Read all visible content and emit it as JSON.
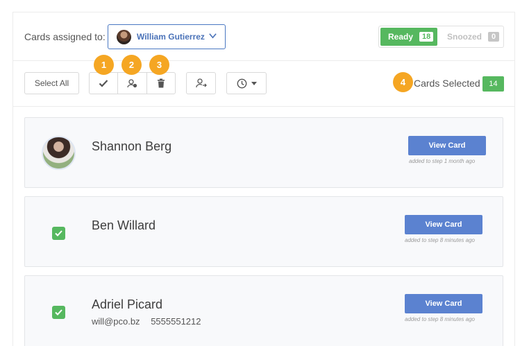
{
  "header": {
    "assigned_label": "Cards assigned to:",
    "assignee_name": "William Gutierrez",
    "ready_label": "Ready",
    "ready_count": "18",
    "snoozed_label": "Snoozed",
    "snoozed_count": "0"
  },
  "toolbar": {
    "select_all_label": "Select All",
    "cards_selected_label": "Cards Selected",
    "cards_selected_count": "14"
  },
  "markers": [
    "1",
    "2",
    "3",
    "4"
  ],
  "cards": [
    {
      "name": "Shannon Berg",
      "view_label": "View Card",
      "meta": "added to step 1 month ago",
      "has_photo": true
    },
    {
      "name": "Ben Willard",
      "view_label": "View Card",
      "meta": "added to step 8 minutes ago",
      "checked": true
    },
    {
      "name": "Adriel Picard",
      "email": "will@pco.bz",
      "phone": "5555551212",
      "view_label": "View Card",
      "meta": "added to step 8 minutes ago",
      "checked": true
    }
  ],
  "colors": {
    "green": "#56b85f",
    "blue": "#5b82d0",
    "marker": "#f5a623"
  },
  "icons": [
    "chevron-down-icon",
    "checkmark-icon",
    "person-remove-icon",
    "trash-icon",
    "person-assign-icon",
    "clock-icon",
    "caret-down-icon",
    "check-icon"
  ]
}
